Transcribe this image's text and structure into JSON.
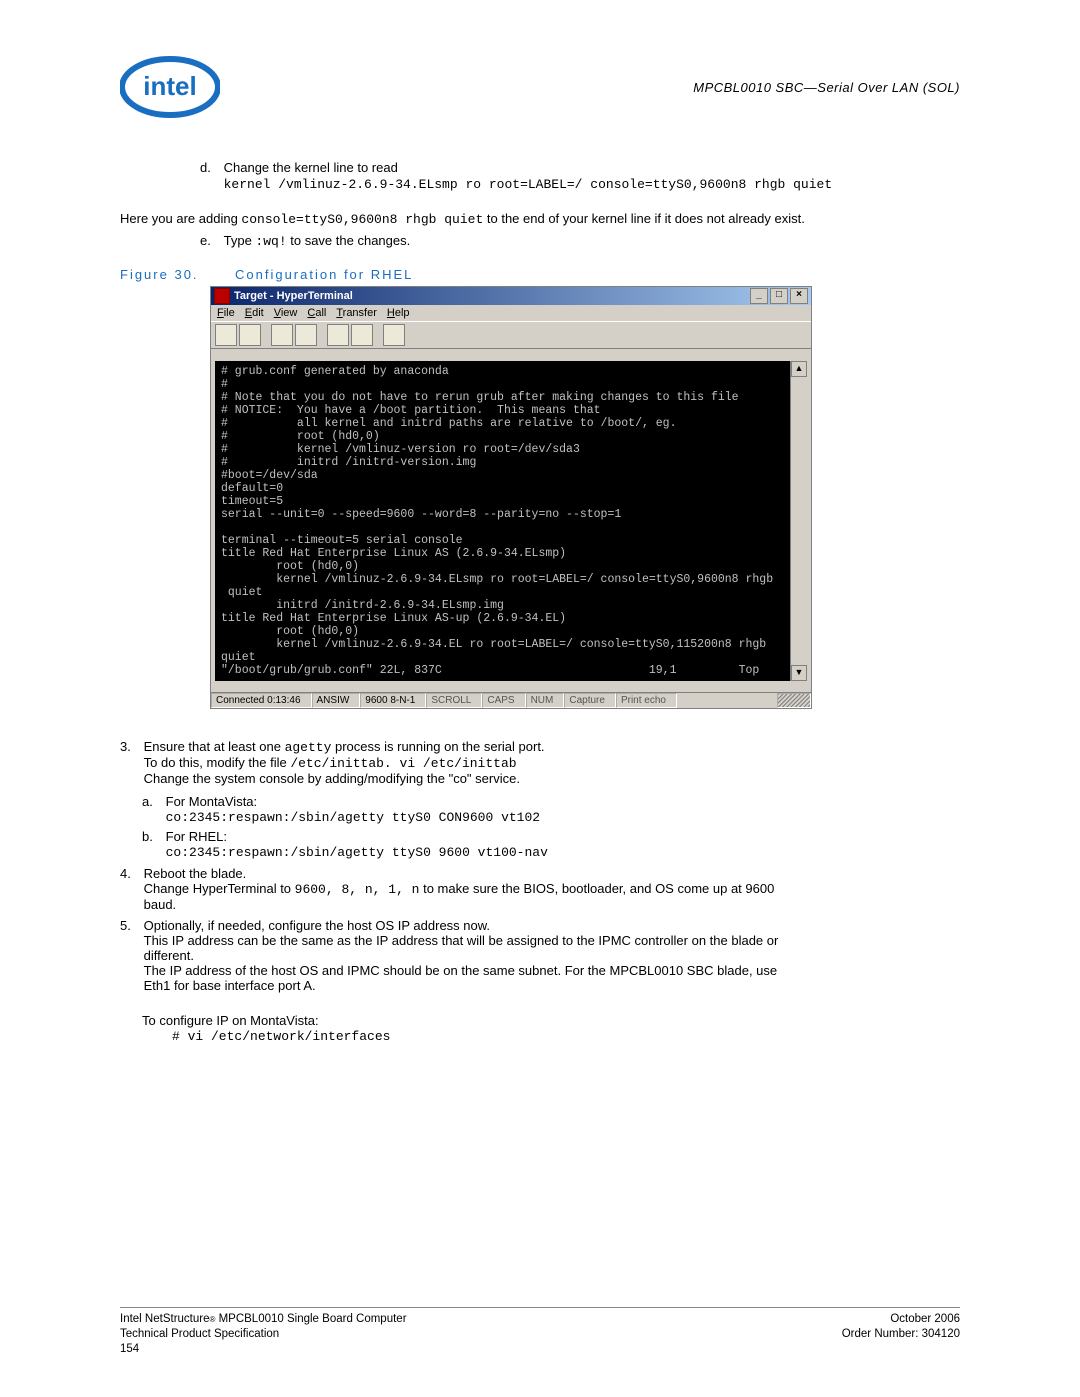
{
  "header": {
    "logo_text": "intel",
    "doc_section": "MPCBL0010 SBC—Serial Over LAN (SOL)"
  },
  "step_d": {
    "label": "d.",
    "text": "Change the kernel line to read",
    "code": "kernel /vmlinuz-2.6.9-34.ELsmp ro root=LABEL=/ console=ttyS0,9600n8 rhgb quiet"
  },
  "note_after_d": {
    "prefix": "Here you are adding ",
    "code": "console=ttyS0,9600n8 rhgb quiet",
    "suffix": " to the end of your kernel line if it does not already exist."
  },
  "step_e": {
    "label": "e.",
    "prefix": "Type ",
    "code": ":wq!",
    "suffix": " to save the changes."
  },
  "figure": {
    "label": "Figure 30.",
    "caption": "Configuration for RHEL"
  },
  "hyperterminal": {
    "title": "Target - HyperTerminal",
    "menu": [
      "File",
      "Edit",
      "View",
      "Call",
      "Transfer",
      "Help"
    ],
    "terminal_text": "# grub.conf generated by anaconda\n#\n# Note that you do not have to rerun grub after making changes to this file\n# NOTICE:  You have a /boot partition.  This means that\n#          all kernel and initrd paths are relative to /boot/, eg.\n#          root (hd0,0)\n#          kernel /vmlinuz-version ro root=/dev/sda3\n#          initrd /initrd-version.img\n#boot=/dev/sda\ndefault=0\ntimeout=5\nserial --unit=0 --speed=9600 --word=8 --parity=no --stop=1\n\nterminal --timeout=5 serial console\ntitle Red Hat Enterprise Linux AS (2.6.9-34.ELsmp)\n        root (hd0,0)\n        kernel /vmlinuz-2.6.9-34.ELsmp ro root=LABEL=/ console=ttyS0,9600n8 rhgb\n quiet\n        initrd /initrd-2.6.9-34.ELsmp.img\ntitle Red Hat Enterprise Linux AS-up (2.6.9-34.EL)\n        root (hd0,0)\n        kernel /vmlinuz-2.6.9-34.EL ro root=LABEL=/ console=ttyS0,115200n8 rhgb\nquiet\n\"/boot/grub/grub.conf\" 22L, 837C                              19,1         Top",
    "status": {
      "connected": "Connected 0:13:46",
      "emulation": "ANSIW",
      "settings": "9600 8-N-1",
      "scroll": "SCROLL",
      "caps": "CAPS",
      "num": "NUM",
      "capture": "Capture",
      "printecho": "Print echo"
    },
    "title_buttons": {
      "min": "_",
      "max": "□",
      "close": "×"
    }
  },
  "step3": {
    "label": "3.",
    "line1_pre": "Ensure that at least one ",
    "line1_code": "agetty",
    "line1_post": " process is running on the serial port.",
    "line2_pre": "To do this, modify the file ",
    "line2_code": "/etc/inittab. vi /etc/inittab",
    "line3": "Change the system console by adding/modifying the \"co\" service."
  },
  "step3a": {
    "label": "a.",
    "text": "For MontaVista:",
    "code": "co:2345:respawn:/sbin/agetty ttyS0 CON9600 vt102"
  },
  "step3b": {
    "label": "b.",
    "text": "For RHEL:",
    "code": "co:2345:respawn:/sbin/agetty ttyS0 9600 vt100-nav"
  },
  "step4": {
    "label": "4.",
    "line1": "Reboot the blade.",
    "line2_pre": "Change HyperTerminal to ",
    "line2_code": "9600, 8, n, 1, n",
    "line2_post": " to make sure the BIOS, bootloader, and OS come up at 9600 baud."
  },
  "step5": {
    "label": "5.",
    "line1": "Optionally, if needed, configure the host OS IP address now.",
    "line2": "This IP address can be the same as the IP address that will be assigned to the IPMC controller on the blade or different.",
    "line3": "The IP address of the host OS and IPMC should be on the same subnet. For the MPCBL0010 SBC blade, use Eth1 for base interface port A."
  },
  "configure_ip": {
    "text": "To configure IP on MontaVista:",
    "code": "# vi /etc/network/interfaces"
  },
  "footer": {
    "left_line1_pre": "Intel NetStructure",
    "left_line1_post": " MPCBL0010 Single Board Computer",
    "left_line2": "Technical Product Specification",
    "left_line3": "154",
    "right_line1": "October 2006",
    "right_line2": "Order Number: 304120"
  }
}
